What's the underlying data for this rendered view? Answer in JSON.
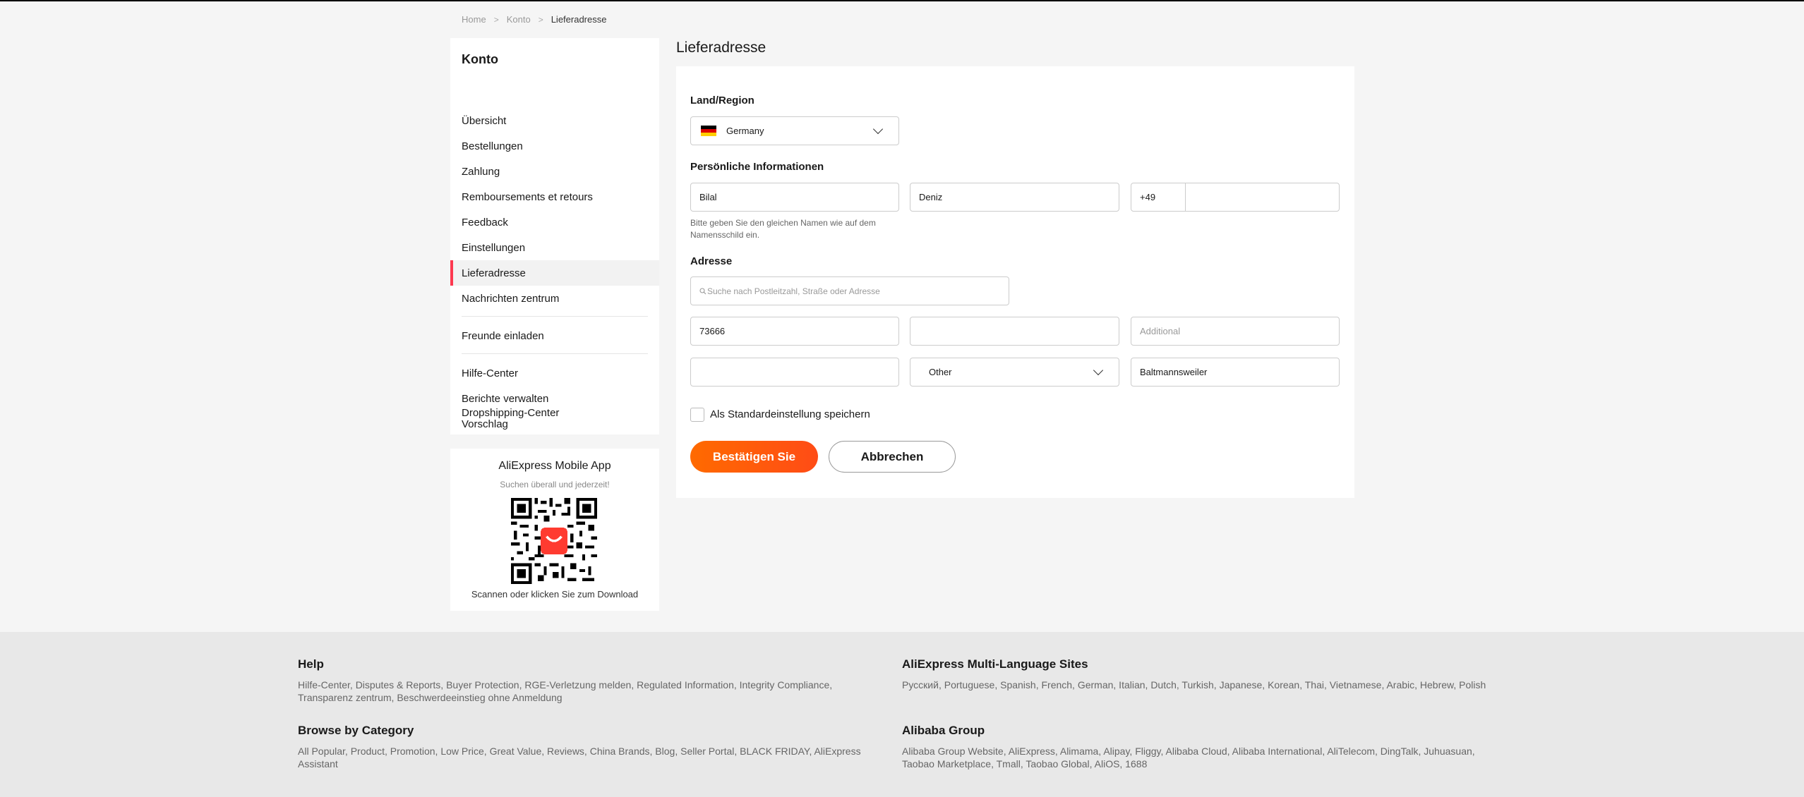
{
  "breadcrumb": [
    "Home",
    "Konto",
    "Lieferadresse"
  ],
  "breadcrumb_sep": ">",
  "sidebar": {
    "title": "Konto",
    "items": [
      {
        "label": "Übersicht"
      },
      {
        "label": "Bestellungen"
      },
      {
        "label": "Zahlung"
      },
      {
        "label": "Remboursements et retours"
      },
      {
        "label": "Feedback"
      },
      {
        "label": "Einstellungen"
      },
      {
        "label": "Lieferadresse",
        "active": true
      },
      {
        "label": "Nachrichten zentrum"
      },
      {
        "label": "Freunde einladen"
      },
      {
        "label": "Hilfe-Center"
      },
      {
        "label": "Berichte verwalten"
      },
      {
        "label": "Vorschlag"
      },
      {
        "label": "Dropshipping-Center"
      }
    ]
  },
  "app_promo": {
    "title": "AliExpress Mobile App",
    "subtitle": "Suchen überall und jederzeit!",
    "scan": "Scannen oder klicken Sie zum Download"
  },
  "main": {
    "title": "Lieferadresse",
    "region_label": "Land/Region",
    "country_value": "Germany",
    "personal_label": "Persönliche Informationen",
    "first_name": "Bilal",
    "last_name": "Deniz",
    "phone_code": "+49",
    "phone_number": "",
    "name_hint": "Bitte geben Sie den gleichen Namen wie auf dem Namensschild ein.",
    "address_label": "Adresse",
    "search_placeholder": "Suche nach Postleitzahl, Straße oder Adresse",
    "zip": "73666",
    "street": "",
    "additional_placeholder": "Additional",
    "field_empty": "",
    "state_value": "Other",
    "city": "Baltmannsweiler",
    "default_checkbox_label": "Als Standardeinstellung speichern",
    "confirm_label": "Bestätigen Sie",
    "cancel_label": "Abbrechen"
  },
  "footer": {
    "help": {
      "title": "Help",
      "links": "Hilfe-Center, Disputes & Reports, Buyer Protection, RGE-Verletzung melden, Regulated Information, Integrity Compliance, Transparenz zentrum, Beschwerdeeinstieg ohne Anmeldung"
    },
    "multi_lang": {
      "title": "AliExpress Multi-Language Sites",
      "links": "Русский, Portuguese, Spanish, French, German, Italian, Dutch, Turkish, Japanese, Korean, Thai, Vietnamese, Arabic, Hebrew, Polish"
    },
    "browse": {
      "title": "Browse by Category",
      "links": "All Popular, Product, Promotion, Low Price, Great Value, Reviews, China Brands, Blog, Seller Portal, BLACK FRIDAY, AliExpress Assistant"
    },
    "alibaba": {
      "title": "Alibaba Group",
      "links": "Alibaba Group Website, AliExpress, Alimama, Alipay, Fliggy, Alibaba Cloud, Alibaba International, AliTelecom, DingTalk, Juhuasuan, Taobao Marketplace, Tmall, Taobao Global, AliOS, 1688"
    }
  },
  "colors": {
    "accent": "#ff4c16",
    "active_marker": "#fd384f",
    "page_bg": "#f5f5f5",
    "footer_bg": "#e8e8e8"
  }
}
